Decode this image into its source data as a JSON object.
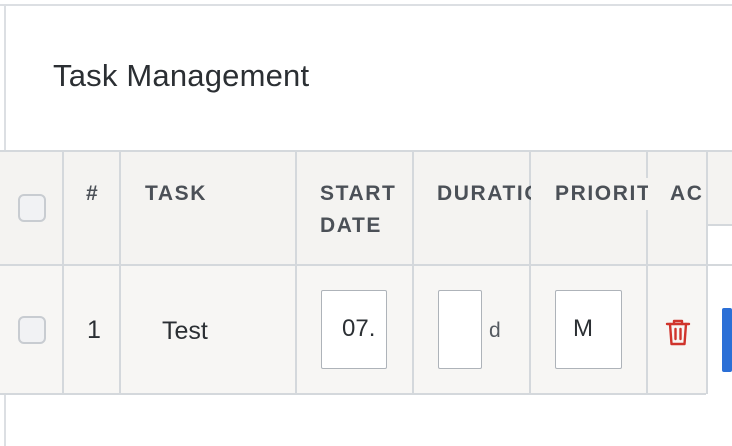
{
  "page": {
    "title": "Task Management"
  },
  "table": {
    "columns": {
      "number": "#",
      "task": "TASK",
      "start_date": "START DATE",
      "start_date_line1": "START",
      "start_date_line2": "DATE",
      "duration": "DURATION",
      "priority": "PRIORITY",
      "actions": "AC"
    },
    "rows": [
      {
        "number": "1",
        "task": "Test",
        "start_date": "07.",
        "duration": "",
        "duration_unit": "d",
        "priority": "M"
      }
    ]
  },
  "colors": {
    "delete_icon": "#d0342c",
    "primary_button": "#2b6fd6"
  },
  "icons": [
    "checkbox-icon",
    "trash-icon"
  ]
}
